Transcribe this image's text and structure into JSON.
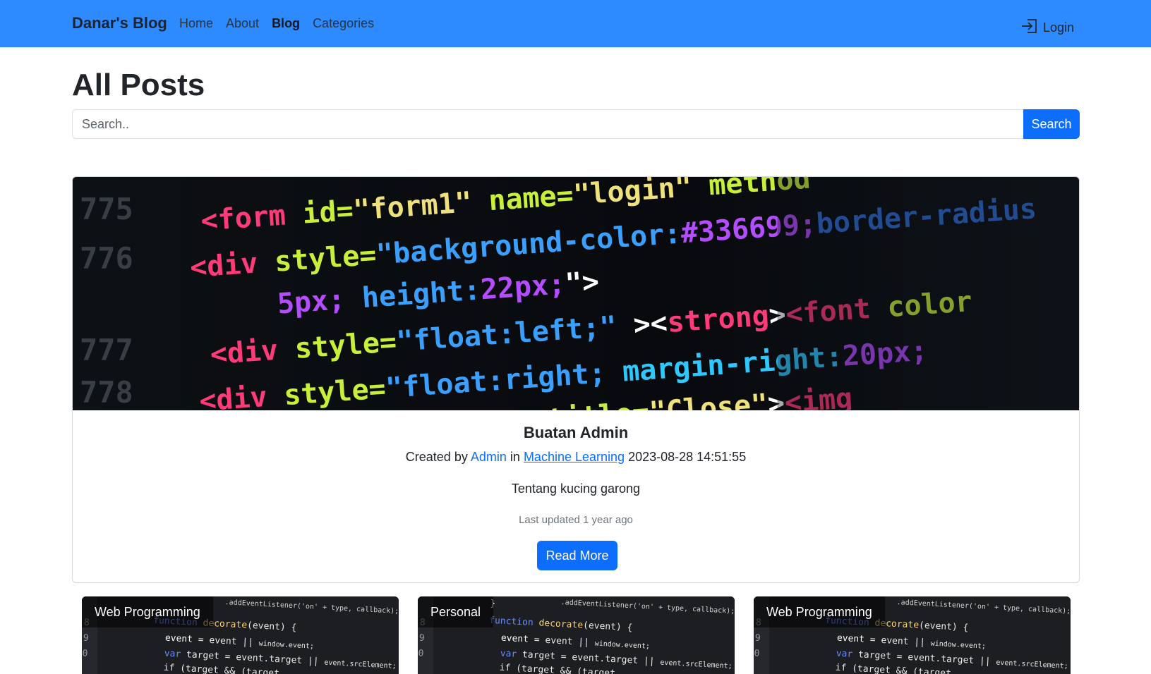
{
  "navbar": {
    "brand": "Danar's Blog",
    "links": [
      "Home",
      "About",
      "Blog",
      "Categories"
    ],
    "active": "Blog",
    "login_label": "Login",
    "background": "#2e8bff"
  },
  "page": {
    "title": "All Posts"
  },
  "search": {
    "placeholder": "Search..",
    "value": "",
    "button_label": "Search"
  },
  "featured_post": {
    "title": "Buatan Admin",
    "meta_prefix": "Created by",
    "author": "Admin",
    "meta_in": "in",
    "category": "Machine Learning",
    "timestamp": "2023-08-28 14:51:55",
    "excerpt": "Tentang kucing garong",
    "updated": "Last updated 1 year ago",
    "read_more_label": "Read More"
  },
  "posts": [
    {
      "category": "Web Programming"
    },
    {
      "category": "Personal"
    },
    {
      "category": "Web Programming"
    }
  ],
  "colors": {
    "primary": "#0d6efd",
    "navbar": "#2e8bff",
    "muted": "#6c757d"
  }
}
